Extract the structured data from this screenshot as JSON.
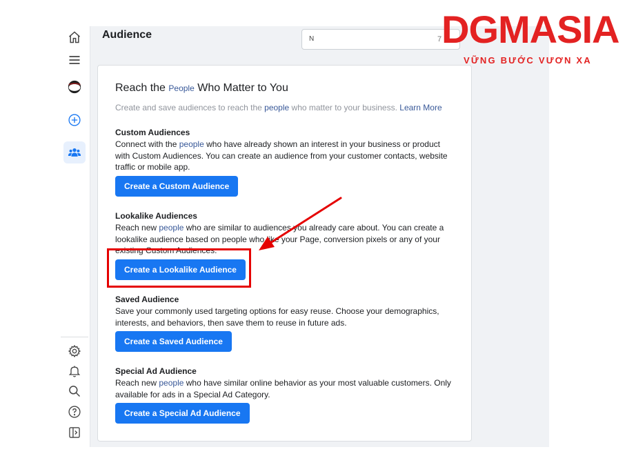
{
  "header": {
    "title": "Audience",
    "search_value": "N",
    "search_hint": "7"
  },
  "logo": {
    "main": "DGMASIA",
    "tagline": "VỮNG BƯỚC VƯƠN XA"
  },
  "card": {
    "title_pre": "Reach the ",
    "title_link": "People",
    "title_post": " Who Matter to You",
    "sub_pre": "Create and save audiences to reach the ",
    "sub_link": "people",
    "sub_post": " who matter to your business. ",
    "sub_learn_more": "Learn More"
  },
  "sections": {
    "custom": {
      "title": "Custom Audiences",
      "desc_pre": "Connect with the ",
      "desc_link": "people",
      "desc_post": " who have already shown an interest in your business or product with Custom Audiences. You can create an audience from your customer contacts, website traffic or mobile app.",
      "button": "Create a Custom Audience"
    },
    "lookalike": {
      "title": "Lookalike Audiences",
      "desc_pre": "Reach new ",
      "desc_link": "people",
      "desc_post": " who are similar to audiences you already care about. You can create a lookalike audience based on people who like your Page, conversion pixels or any of your existing Custom Audiences.",
      "button": "Create a Lookalike Audience"
    },
    "saved": {
      "title": "Saved Audience",
      "desc": "Save your commonly used targeting options for easy reuse. Choose your demographics, interests, and behaviors, then save them to reuse in future ads.",
      "button": "Create a Saved Audience"
    },
    "special": {
      "title": "Special Ad Audience",
      "desc_pre": "Reach new ",
      "desc_link": "people",
      "desc_post": " who have similar online behavior as your most valuable customers. Only available for ads in a Special Ad Category.",
      "button": "Create a Special Ad Audience"
    }
  },
  "rail": {
    "icons": [
      "home-icon",
      "menu-icon",
      "account-avatar",
      "create-icon",
      "audiences-icon",
      "settings-icon",
      "notifications-icon",
      "search-icon",
      "help-icon",
      "collapse-panel-icon"
    ],
    "accent": "#1877f2",
    "active_bg": "#e7f0fd"
  },
  "colors": {
    "button_bg": "#1877f2",
    "link": "#385898",
    "highlight": "#e50000",
    "logo": "#e32222"
  }
}
